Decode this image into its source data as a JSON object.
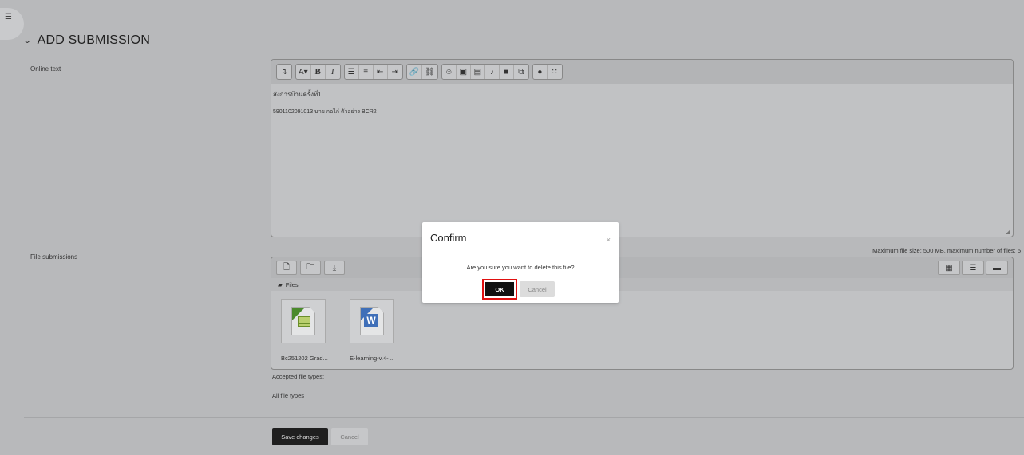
{
  "section": {
    "title": "ADD SUBMISSION",
    "chevron_icon": "chevron-down-icon"
  },
  "online_text": {
    "label": "Online text",
    "toolbar": [
      "show-more-icon",
      "font-size-icon",
      "bold-icon",
      "italic-icon",
      "unordered-list-icon",
      "ordered-list-icon",
      "outdent-icon",
      "indent-icon",
      "link-icon",
      "unlink-icon",
      "emoji-icon",
      "image-icon",
      "media-icon",
      "audio-icon",
      "video-icon",
      "manage-files-icon",
      "accessibility-icon",
      "equation-icon"
    ],
    "font_size_label": "A▾",
    "bold_label": "B",
    "italic_label": "I",
    "content_line1": "ส่งการบ้านครั้งที่1",
    "content_line2": "5901102091013 นาย กอไก่ ตัวอย่าง BCR2"
  },
  "file_submissions": {
    "label": "File submissions",
    "max_size_text": "Maximum file size: 500 MB, maximum number of files: 5",
    "path_label": "Files",
    "files": [
      {
        "name": "Bc251202 Grad...",
        "type": "spreadsheet"
      },
      {
        "name": "E-learning-v.4-...",
        "type": "word"
      }
    ],
    "accepted_label": "Accepted file types:",
    "accepted_value": "All file types"
  },
  "form_buttons": {
    "save": "Save changes",
    "cancel": "Cancel"
  },
  "modal": {
    "title": "Confirm",
    "close": "×",
    "message": "Are you sure you want to delete this file?",
    "ok": "OK",
    "cancel": "Cancel",
    "highlight_color": "#e01010"
  }
}
